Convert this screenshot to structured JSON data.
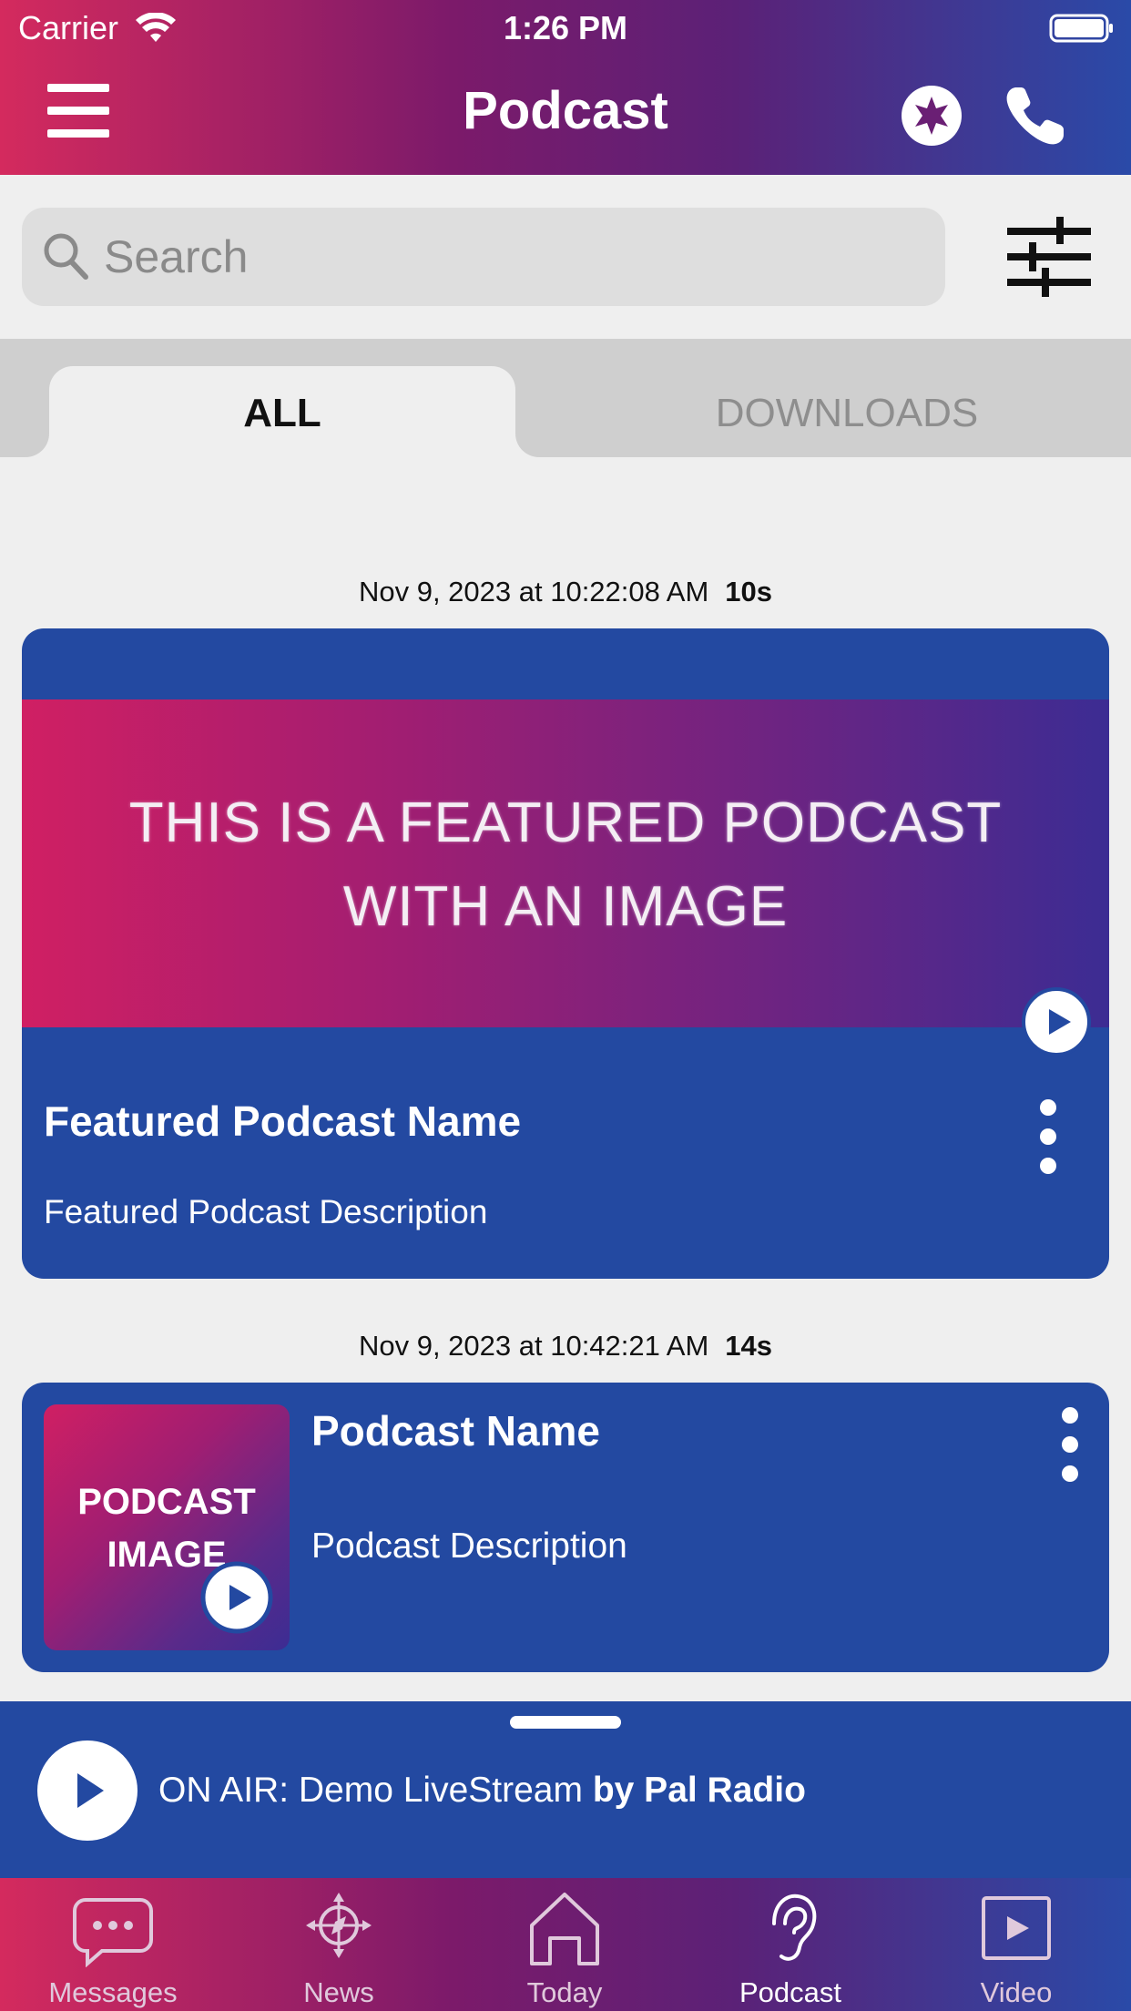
{
  "status_bar": {
    "carrier": "Carrier",
    "time": "1:26 PM"
  },
  "header": {
    "title": "Podcast"
  },
  "search": {
    "placeholder": "Search"
  },
  "tabs": [
    {
      "label": "ALL",
      "active": true
    },
    {
      "label": "DOWNLOADS",
      "active": false
    }
  ],
  "featured": {
    "date": "Nov 9, 2023 at 10:22:08 AM",
    "duration": "10s",
    "banner_line1": "THIS IS A FEATURED PODCAST",
    "banner_line2": "WITH AN IMAGE",
    "title": "Featured Podcast Name",
    "description": "Featured Podcast Description"
  },
  "podcast": {
    "date": "Nov 9, 2023 at 10:42:21 AM",
    "duration": "14s",
    "thumb_line1": "PODCAST",
    "thumb_line2": "IMAGE",
    "title": "Podcast Name",
    "description": "Podcast Description"
  },
  "player": {
    "prefix": "ON AIR: Demo LiveStream",
    "by": "by Pal Radio"
  },
  "tabbar": [
    {
      "label": "Messages",
      "icon": "chat-bubble-icon"
    },
    {
      "label": "News",
      "icon": "compass-icon"
    },
    {
      "label": "Today",
      "icon": "home-icon"
    },
    {
      "label": "Podcast",
      "icon": "ear-icon",
      "active": true
    },
    {
      "label": "Video",
      "icon": "video-play-icon"
    }
  ],
  "colors": {
    "card_blue": "#2349a1",
    "gradient_start": "#d42a5e",
    "gradient_end": "#2a4aa8",
    "background": "#efefef"
  }
}
